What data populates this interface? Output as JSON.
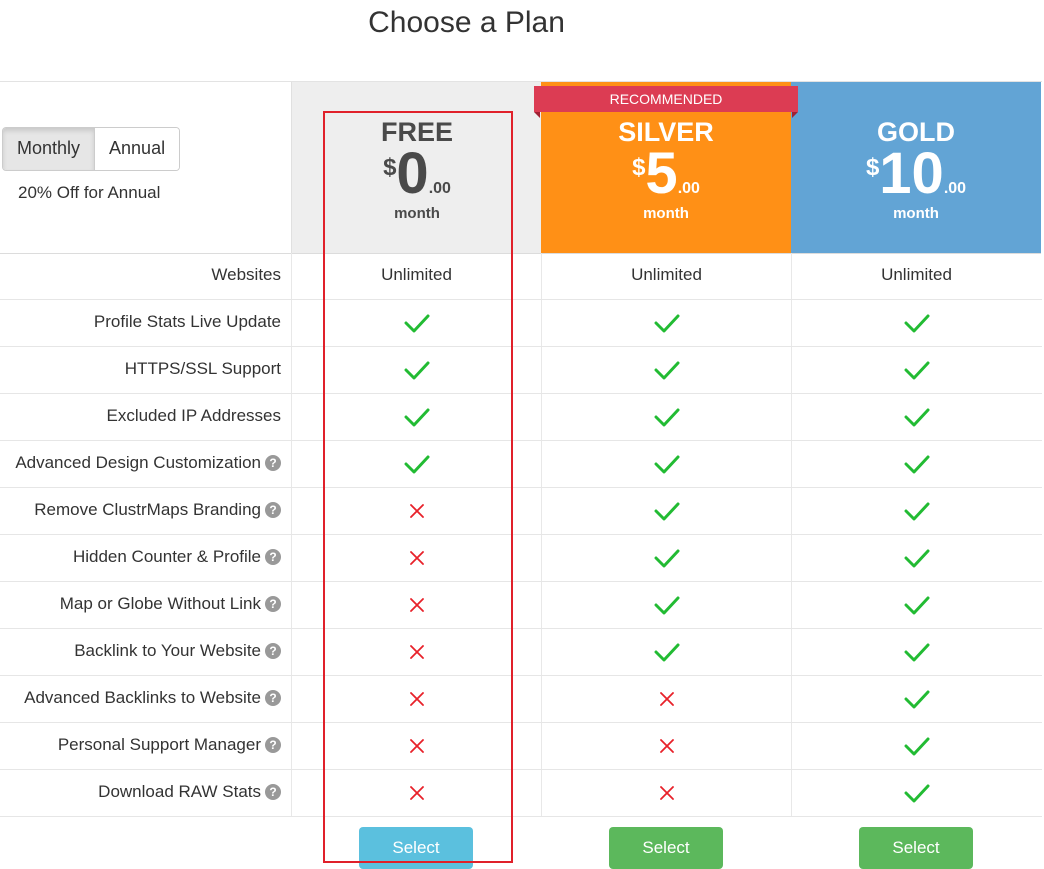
{
  "page": {
    "title": "Choose a Plan"
  },
  "billing": {
    "options": [
      "Monthly",
      "Annual"
    ],
    "selected": "Monthly",
    "discount_note": "20% Off for Annual"
  },
  "ribbon": "RECOMMENDED",
  "plans": [
    {
      "name": "FREE",
      "currency": "$",
      "amount": "0",
      "cents": ".00",
      "period": "month",
      "button": "Select",
      "color": "#eeeeee"
    },
    {
      "name": "SILVER",
      "currency": "$",
      "amount": "5",
      "cents": ".00",
      "period": "month",
      "button": "Select",
      "color": "#ff9016"
    },
    {
      "name": "GOLD",
      "currency": "$",
      "amount": "10",
      "cents": ".00",
      "period": "month",
      "button": "Select",
      "color": "#62a4d5"
    }
  ],
  "features": [
    {
      "label": "Websites",
      "help": false,
      "values": [
        "Unlimited",
        "Unlimited",
        "Unlimited"
      ]
    },
    {
      "label": "Profile Stats Live Update",
      "help": false,
      "values": [
        true,
        true,
        true
      ]
    },
    {
      "label": "HTTPS/SSL Support",
      "help": false,
      "values": [
        true,
        true,
        true
      ]
    },
    {
      "label": "Excluded IP Addresses",
      "help": false,
      "values": [
        true,
        true,
        true
      ]
    },
    {
      "label": "Advanced Design Customization",
      "help": true,
      "values": [
        true,
        true,
        true
      ]
    },
    {
      "label": "Remove ClustrMaps Branding",
      "help": true,
      "values": [
        false,
        true,
        true
      ]
    },
    {
      "label": "Hidden Counter & Profile",
      "help": true,
      "values": [
        false,
        true,
        true
      ]
    },
    {
      "label": "Map or Globe Without Link",
      "help": true,
      "values": [
        false,
        true,
        true
      ]
    },
    {
      "label": "Backlink to Your Website",
      "help": true,
      "values": [
        false,
        true,
        true
      ]
    },
    {
      "label": "Advanced Backlinks to Website",
      "help": true,
      "values": [
        false,
        false,
        true
      ]
    },
    {
      "label": "Personal Support Manager",
      "help": true,
      "values": [
        false,
        false,
        true
      ]
    },
    {
      "label": "Download RAW Stats",
      "help": true,
      "values": [
        false,
        false,
        true
      ]
    }
  ],
  "colors": {
    "check": "#22bb33",
    "cross": "#e8212a",
    "select_free": "#5bc0de",
    "select_paid": "#5cb85c",
    "highlight": "#e0202a"
  }
}
